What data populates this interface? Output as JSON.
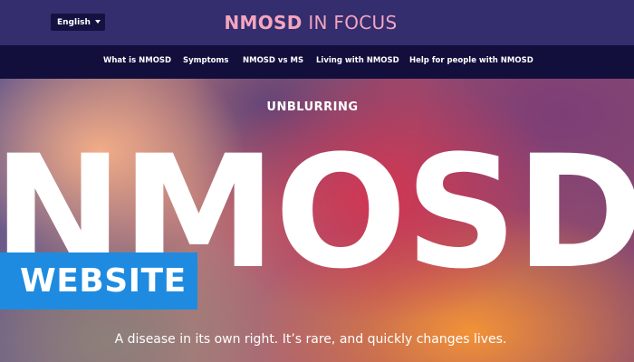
{
  "header": {
    "language_select": {
      "value": "English"
    },
    "brand": {
      "part1": "NMOSD",
      "part2": " IN FOCUS"
    }
  },
  "nav": {
    "items": [
      {
        "label": "What is NMOSD"
      },
      {
        "label": "Symptoms"
      },
      {
        "label": "NMOSD vs MS"
      },
      {
        "label": "Living with NMOSD"
      },
      {
        "label": "Help for people with NMOSD"
      }
    ]
  },
  "hero": {
    "kicker": "UNBLURRING",
    "headline": "NMOSD",
    "subtitle": "A disease in its own right. It’s rare, and quickly changes lives."
  },
  "badge": {
    "label": "WEBSITE"
  },
  "colors": {
    "header_bg": "#342d6e",
    "nav_bg": "#120f3c",
    "brand_accent": "#f3a5bf",
    "badge_bg": "#1e8be0"
  }
}
